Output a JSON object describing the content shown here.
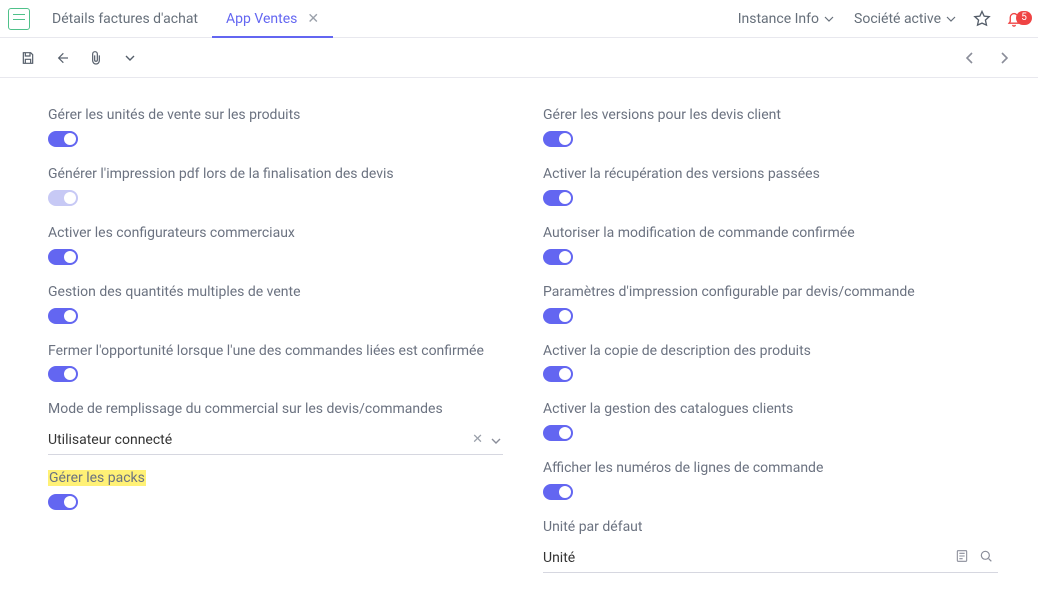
{
  "tabs": {
    "inactive1": "Détails factures d'achat",
    "active": "App Ventes"
  },
  "topmenu": {
    "instance": "Instance Info",
    "company": "Société active",
    "bell_count": "5"
  },
  "left": [
    {
      "label": "Gérer les unités de vente sur les produits"
    },
    {
      "label": "Générer l'impression pdf lors de la finalisation des devis",
      "disabled": true
    },
    {
      "label": "Activer les configurateurs commerciaux"
    },
    {
      "label": "Gestion des quantités multiples de vente"
    },
    {
      "label": "Fermer l'opportunité lorsque l'une des commandes liées est confirmée"
    }
  ],
  "left_select": {
    "label": "Mode de remplissage du commercial sur les devis/commandes",
    "value": "Utilisateur connecté"
  },
  "left_packs": {
    "label": "Gérer les packs"
  },
  "right": [
    {
      "label": "Gérer les versions pour les devis client"
    },
    {
      "label": "Activer la récupération des versions passées"
    },
    {
      "label": "Autoriser la modification de commande confirmée"
    },
    {
      "label": "Paramètres d'impression configurable par devis/commande"
    },
    {
      "label": "Activer la copie de description des produits"
    },
    {
      "label": "Activer la gestion des catalogues clients"
    },
    {
      "label": "Afficher les numéros de lignes de commande"
    }
  ],
  "right_unit": {
    "label": "Unité par défaut",
    "value": "Unité"
  }
}
